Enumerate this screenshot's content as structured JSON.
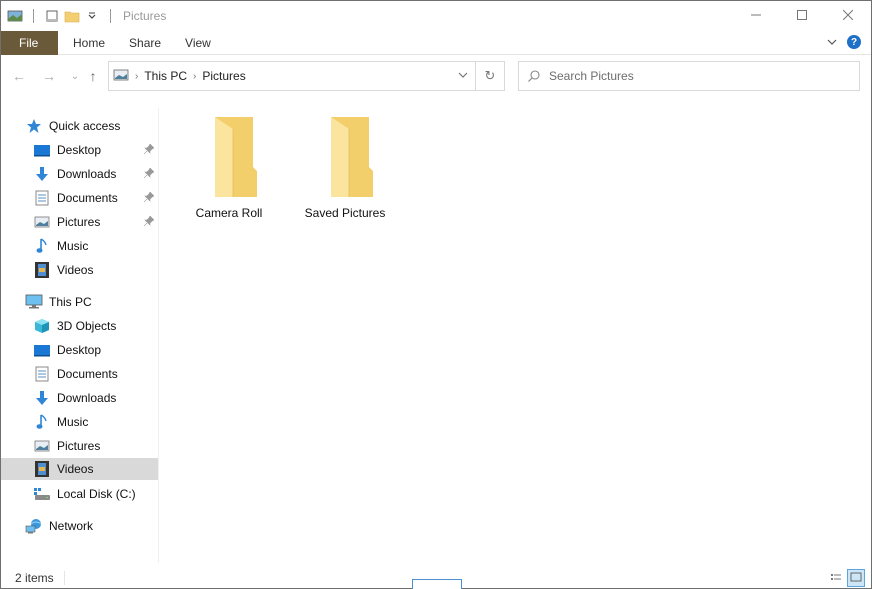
{
  "window": {
    "title": "Pictures",
    "controls": {
      "minimize_icon": "minimize-icon",
      "maximize_icon": "maximize-icon",
      "close_icon": "close-icon"
    }
  },
  "quick_access_toolbar": {
    "items": [
      {
        "name": "app-icon",
        "icon": "picture-folder-icon"
      },
      {
        "name": "properties-button",
        "icon": "properties-icon"
      },
      {
        "name": "new-folder-button",
        "icon": "new-folder-icon"
      },
      {
        "name": "customize-qat-button",
        "icon": "chevron-down-icon"
      }
    ]
  },
  "ribbon": {
    "tabs": [
      {
        "label": "File",
        "active": true
      },
      {
        "label": "Home"
      },
      {
        "label": "Share"
      },
      {
        "label": "View"
      }
    ],
    "expand_icon": "chevron-down-icon",
    "help_icon": "help-icon",
    "help_glyph": "?"
  },
  "navigation": {
    "back_glyph": "←",
    "forward_glyph": "→",
    "recent_glyph": "⌄",
    "up_glyph": "↑",
    "breadcrumb": [
      "This PC",
      "Pictures"
    ],
    "breadcrumb_sep": "›",
    "dropdown_glyph": "⌄",
    "refresh_glyph": "↻",
    "search": {
      "placeholder": "Search Pictures",
      "value": ""
    }
  },
  "sidebar": {
    "quick_access": {
      "label": "Quick access",
      "items": [
        {
          "label": "Desktop",
          "icon": "desktop-icon",
          "pinned": true
        },
        {
          "label": "Downloads",
          "icon": "downloads-icon",
          "pinned": true
        },
        {
          "label": "Documents",
          "icon": "documents-icon",
          "pinned": true
        },
        {
          "label": "Pictures",
          "icon": "pictures-icon",
          "pinned": true
        },
        {
          "label": "Music",
          "icon": "music-icon",
          "pinned": false
        },
        {
          "label": "Videos",
          "icon": "videos-icon",
          "pinned": false
        }
      ]
    },
    "this_pc": {
      "label": "This PC",
      "items": [
        {
          "label": "3D Objects",
          "icon": "3d-objects-icon"
        },
        {
          "label": "Desktop",
          "icon": "desktop-icon"
        },
        {
          "label": "Documents",
          "icon": "documents-icon"
        },
        {
          "label": "Downloads",
          "icon": "downloads-icon"
        },
        {
          "label": "Music",
          "icon": "music-icon"
        },
        {
          "label": "Pictures",
          "icon": "pictures-icon"
        },
        {
          "label": "Videos",
          "icon": "videos-icon",
          "selected": true
        },
        {
          "label": "Local Disk (C:)",
          "icon": "drive-icon"
        }
      ]
    },
    "network": {
      "label": "Network",
      "icon": "network-icon"
    },
    "pin_glyph": "📌"
  },
  "content": {
    "items": [
      {
        "name": "Camera Roll",
        "type": "folder"
      },
      {
        "name": "Saved Pictures",
        "type": "folder"
      }
    ]
  },
  "status_bar": {
    "item_count": "2 items",
    "views": [
      "details-view-icon",
      "large-icons-view-icon"
    ],
    "active_view": "large-icons-view-icon"
  },
  "colors": {
    "file_tab": "#6b5a3a",
    "accent": "#1e6fc7",
    "selection": "#d9d9d9",
    "folder": "#f6d57a"
  }
}
